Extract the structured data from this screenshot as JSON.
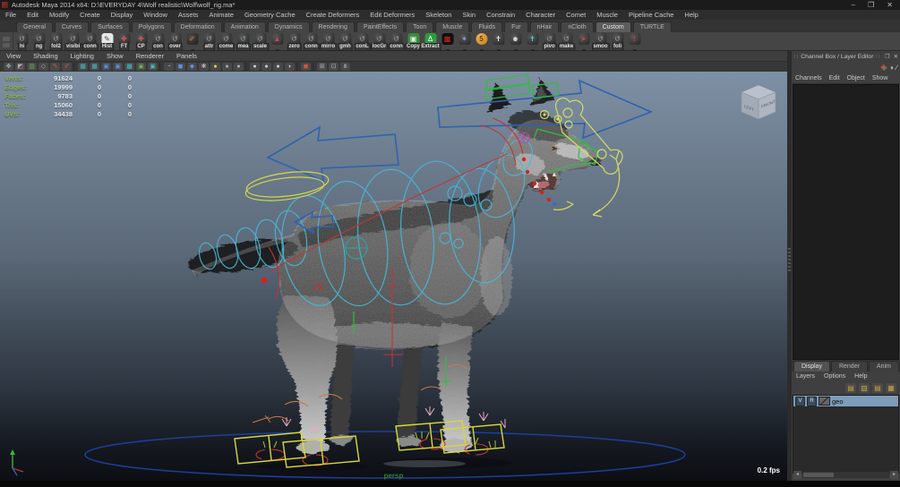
{
  "window": {
    "title": "Autodesk Maya 2014 x64: D:\\EVERYDAY 4\\Wolf realistic\\Wolf\\wolf_rig.ma*",
    "controls": {
      "minimize": "–",
      "restore": "❐",
      "close": "✕"
    }
  },
  "menubar": [
    "File",
    "Edit",
    "Modify",
    "Create",
    "Display",
    "Window",
    "Assets",
    "Animate",
    "Geometry Cache",
    "Create Deformers",
    "Edit Deformers",
    "Skeleton",
    "Skin",
    "Constrain",
    "Character",
    "Comet",
    "Muscle",
    "Pipeline Cache",
    "Help"
  ],
  "shelf": {
    "tabs": [
      {
        "label": "General"
      },
      {
        "label": "Curves"
      },
      {
        "label": "Surfaces"
      },
      {
        "label": "Polygons"
      },
      {
        "label": "Deformation"
      },
      {
        "label": "Animation"
      },
      {
        "label": "Dynamics"
      },
      {
        "label": "Rendering"
      },
      {
        "label": "PaintEffects"
      },
      {
        "label": "Toon"
      },
      {
        "label": "Muscle"
      },
      {
        "label": "Fluids"
      },
      {
        "label": "Fur"
      },
      {
        "label": "nHair"
      },
      {
        "label": "nCloth"
      },
      {
        "label": "Custom",
        "active": "active"
      },
      {
        "label": "TURTLE"
      }
    ],
    "items": [
      {
        "label": "hi",
        "cls": "pose",
        "glyph": "↺"
      },
      {
        "label": "ng",
        "cls": "pose",
        "glyph": "↺"
      },
      {
        "label": "fol2",
        "cls": "pose",
        "glyph": "↺"
      },
      {
        "label": "visibi",
        "cls": "pose",
        "glyph": "↺"
      },
      {
        "label": "conn",
        "cls": "pose",
        "glyph": "↺"
      },
      {
        "label": "Hist",
        "cls": "edit",
        "glyph": "✎"
      },
      {
        "label": "FT",
        "cls": "joint",
        "glyph": "✚"
      },
      {
        "label": "CP",
        "cls": "joint",
        "glyph": "✚"
      },
      {
        "label": "con",
        "cls": "pose",
        "glyph": "↺"
      },
      {
        "label": "over",
        "cls": "pose",
        "glyph": "↺"
      },
      {
        "label": "",
        "cls": "brush",
        "glyph": "✐"
      },
      {
        "label": "attr",
        "cls": "pose",
        "glyph": "↺"
      },
      {
        "label": "come",
        "cls": "pose",
        "glyph": "↺"
      },
      {
        "label": "mea",
        "cls": "pose",
        "glyph": "↺"
      },
      {
        "label": "scale",
        "cls": "pose",
        "glyph": "↺"
      },
      {
        "label": "",
        "cls": "cone",
        "glyph": "▲"
      },
      {
        "label": "zero",
        "cls": "pose",
        "glyph": "↺"
      },
      {
        "label": "conn",
        "cls": "pose",
        "glyph": "↺"
      },
      {
        "label": "mirro",
        "cls": "pose",
        "glyph": "↺"
      },
      {
        "label": "gmh",
        "cls": "pose",
        "glyph": "↺"
      },
      {
        "label": "conL",
        "cls": "pose",
        "glyph": "↺"
      },
      {
        "label": "locGr",
        "cls": "pose",
        "glyph": "↺"
      },
      {
        "label": "conn",
        "cls": "pose",
        "glyph": "↺"
      },
      {
        "label": "Copy",
        "cls": "green",
        "glyph": "▣"
      },
      {
        "label": "Extract",
        "cls": "green2",
        "glyph": "Δ"
      },
      {
        "label": "",
        "cls": "checker",
        "glyph": "▩"
      },
      {
        "label": "",
        "cls": "atoms",
        "glyph": "✶"
      },
      {
        "label": "",
        "cls": "orange",
        "glyph": "5"
      },
      {
        "label": "",
        "cls": "figw",
        "glyph": "✝"
      },
      {
        "label": "",
        "cls": "mask",
        "glyph": "☻"
      },
      {
        "label": "",
        "cls": "figc",
        "glyph": "✝"
      },
      {
        "label": "pivo",
        "cls": "pose",
        "glyph": "↺"
      },
      {
        "label": "make",
        "cls": "pose",
        "glyph": "↺"
      },
      {
        "label": "",
        "cls": "arrow",
        "glyph": "➤"
      },
      {
        "label": "smoo",
        "cls": "pose",
        "glyph": "↺"
      },
      {
        "label": "foli",
        "cls": "pose",
        "glyph": "↺"
      },
      {
        "label": "",
        "cls": "excl",
        "glyph": "!"
      }
    ]
  },
  "panel_menu": [
    "View",
    "Shading",
    "Lighting",
    "Show",
    "Renderer",
    "Panels"
  ],
  "vp_toolbar": [
    {
      "g": "✥",
      "c": "c-gray"
    },
    {
      "g": "◩",
      "c": "c-gray"
    },
    {
      "g": "▥",
      "c": "c-green"
    },
    {
      "g": "◇",
      "c": "c-gray"
    },
    {
      "g": "✎",
      "c": "c-red"
    },
    {
      "g": "✐",
      "c": "c-red"
    },
    {
      "g": "",
      "c": "sep"
    },
    {
      "g": "▦",
      "c": "c-teal"
    },
    {
      "g": "▦",
      "c": "c-teal"
    },
    {
      "g": "▣",
      "c": "c-blue"
    },
    {
      "g": "▣",
      "c": "c-blue"
    },
    {
      "g": "▩",
      "c": "c-teal"
    },
    {
      "g": "▣",
      "c": "c-green"
    },
    {
      "g": "▣",
      "c": "c-teal"
    },
    {
      "g": "",
      "c": "sep"
    },
    {
      "g": "◔",
      "c": "c-gray"
    },
    {
      "g": "◼",
      "c": "c-blue"
    },
    {
      "g": "◆",
      "c": "c-blue"
    },
    {
      "g": "✱",
      "c": "c-gray"
    },
    {
      "g": "●",
      "c": "c-yellow"
    },
    {
      "g": "●",
      "c": "c-gray"
    },
    {
      "g": "●",
      "c": "c-gray"
    },
    {
      "g": "",
      "c": "sep"
    },
    {
      "g": "●",
      "c": "c-light"
    },
    {
      "g": "●",
      "c": "c-light"
    },
    {
      "g": "●",
      "c": "c-light"
    },
    {
      "g": "◗",
      "c": "c-light"
    },
    {
      "g": "",
      "c": "sep"
    },
    {
      "g": "◼",
      "c": "c-red"
    },
    {
      "g": "",
      "c": "sep"
    },
    {
      "g": "⊞",
      "c": "c-gray"
    },
    {
      "g": "⊡",
      "c": "c-gray"
    },
    {
      "g": "⋔",
      "c": "c-gray"
    }
  ],
  "hud": {
    "rows": [
      {
        "label": "Verts:",
        "total": "91624",
        "c2": "0",
        "c3": "0"
      },
      {
        "label": "Edges:",
        "total": "19999",
        "c2": "0",
        "c3": "0"
      },
      {
        "label": "Faces:",
        "total": "9783",
        "c2": "0",
        "c3": "0"
      },
      {
        "label": "Tris:",
        "total": "15060",
        "c2": "0",
        "c3": "0"
      },
      {
        "label": "UVs:",
        "total": "34438",
        "c2": "0",
        "c3": "0"
      }
    ]
  },
  "viewport": {
    "camera": "persp",
    "fps": "0.2 fps",
    "cube_left": "LEFT",
    "cube_front": "FRONT"
  },
  "channel_box": {
    "title": "Channel Box / Layer Editor",
    "window_buttons": {
      "float": "❐",
      "close": "✕"
    },
    "tools": [
      {
        "g": "✚",
        "c": "rgbicon"
      },
      {
        "g": "◑",
        "c": "grayicon"
      },
      {
        "g": "∕",
        "c": "grayicon"
      }
    ],
    "menus": [
      "Channels",
      "Edit",
      "Object",
      "Show"
    ]
  },
  "layer_editor": {
    "tabs": [
      {
        "label": "Display",
        "active": "active"
      },
      {
        "label": "Render"
      },
      {
        "label": "Anim"
      }
    ],
    "menus": [
      "Layers",
      "Options",
      "Help"
    ],
    "ops": [
      {
        "g": "▤"
      },
      {
        "g": "▧"
      },
      {
        "g": "▤"
      },
      {
        "g": "▦"
      }
    ],
    "layer": {
      "visible": "V",
      "render": "R",
      "name": "geo"
    },
    "scroll": {
      "left": "◂",
      "right": "▸"
    }
  },
  "colors": {
    "selection_blue": "#7d9cbc",
    "hud_label_green": "#8cb14e",
    "rig_cyan": "#46b8d8",
    "rig_yellow": "#d8d838",
    "rig_red": "#c43434",
    "rig_green": "#33bb44",
    "arrow_blue": "#2f62b0",
    "ground_blue": "#1d3e9c"
  }
}
